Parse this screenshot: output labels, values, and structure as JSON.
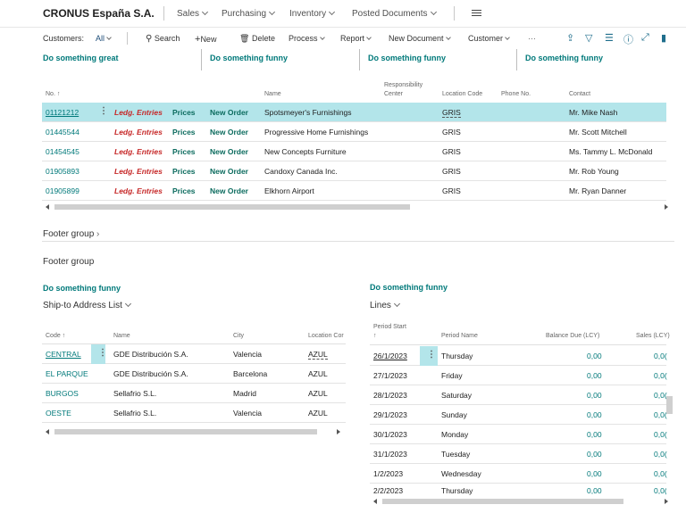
{
  "nav": {
    "company": "CRONUS España S.A.",
    "items": [
      "Sales",
      "Purchasing",
      "Inventory",
      "Posted Documents"
    ]
  },
  "actions": {
    "filter_label": "Customers:",
    "filter_value": "All",
    "search": "Search",
    "new": "New",
    "delete": "Delete",
    "process": "Process",
    "report": "Report",
    "new_document": "New Document",
    "customer": "Customer",
    "more": "···"
  },
  "cues": [
    "Do something great",
    "Do something funny",
    "Do something funny",
    "Do something funny"
  ],
  "main_table": {
    "headers": {
      "no": "No. ↑",
      "name": "Name",
      "resp_center_1": "Responsibility",
      "resp_center_2": "Center",
      "location": "Location Code",
      "phone": "Phone No.",
      "contact": "Contact"
    },
    "rows": [
      {
        "no": "01121212",
        "ledg": "Ledg. Entries",
        "prices": "Prices",
        "order": "New Order",
        "name": "Spotsmeyer's Furnishings",
        "loc": "GRIS",
        "contact": "Mr. Mike Nash"
      },
      {
        "no": "01445544",
        "ledg": "Ledg. Entries",
        "prices": "Prices",
        "order": "New Order",
        "name": "Progressive Home Furnishings",
        "loc": "GRIS",
        "contact": "Mr. Scott Mitchell"
      },
      {
        "no": "01454545",
        "ledg": "Ledg. Entries",
        "prices": "Prices",
        "order": "New Order",
        "name": "New Concepts Furniture",
        "loc": "GRIS",
        "contact": "Ms. Tammy L. McDonald"
      },
      {
        "no": "01905893",
        "ledg": "Ledg. Entries",
        "prices": "Prices",
        "order": "New Order",
        "name": "Candoxy Canada Inc.",
        "loc": "GRIS",
        "contact": "Mr. Rob Young"
      },
      {
        "no": "01905899",
        "ledg": "Ledg. Entries",
        "prices": "Prices",
        "order": "New Order",
        "name": "Elkhorn Airport",
        "loc": "GRIS",
        "contact": "Mr. Ryan Danner"
      }
    ]
  },
  "footer": {
    "group_link": "Footer group",
    "group_title": "Footer group"
  },
  "ship_to": {
    "cue": "Do something funny",
    "title": "Ship-to Address List",
    "headers": {
      "code": "Code ↑",
      "name": "Name",
      "city": "City",
      "location": "Location Cor"
    },
    "rows": [
      {
        "code": "CENTRAL",
        "name": "GDE Distribución S.A.",
        "city": "Valencia",
        "loc": "AZUL"
      },
      {
        "code": "EL PARQUE",
        "name": "GDE Distribución S.A.",
        "city": "Barcelona",
        "loc": "AZUL"
      },
      {
        "code": "BURGOS",
        "name": "Sellafrio S.L.",
        "city": "Madrid",
        "loc": "AZUL"
      },
      {
        "code": "OESTE",
        "name": "Sellafrio S.L.",
        "city": "Valencia",
        "loc": "AZUL"
      }
    ]
  },
  "lines": {
    "cue": "Do something funny",
    "title": "Lines",
    "headers": {
      "period_start_1": "Period Start",
      "period_start_2": "↑",
      "period_name": "Period Name",
      "balance": "Balance Due (LCY)",
      "sales": "Sales (LCY)"
    },
    "rows": [
      {
        "start": "26/1/2023",
        "name": "Thursday",
        "balance": "0,00",
        "sales": "0,0("
      },
      {
        "start": "27/1/2023",
        "name": "Friday",
        "balance": "0,00",
        "sales": "0,0("
      },
      {
        "start": "28/1/2023",
        "name": "Saturday",
        "balance": "0,00",
        "sales": "0,0("
      },
      {
        "start": "29/1/2023",
        "name": "Sunday",
        "balance": "0,00",
        "sales": "0,0("
      },
      {
        "start": "30/1/2023",
        "name": "Monday",
        "balance": "0,00",
        "sales": "0,0("
      },
      {
        "start": "31/1/2023",
        "name": "Tuesday",
        "balance": "0,00",
        "sales": "0,0("
      },
      {
        "start": "1/2/2023",
        "name": "Wednesday",
        "balance": "0,00",
        "sales": "0,0("
      },
      {
        "start": "2/2/2023",
        "name": "Thursday",
        "balance": "0,00",
        "sales": "0,0("
      }
    ]
  },
  "colors": {
    "accent": "#00797a",
    "selected_row": "#b3e5ea",
    "ledger_red": "#c62828"
  }
}
